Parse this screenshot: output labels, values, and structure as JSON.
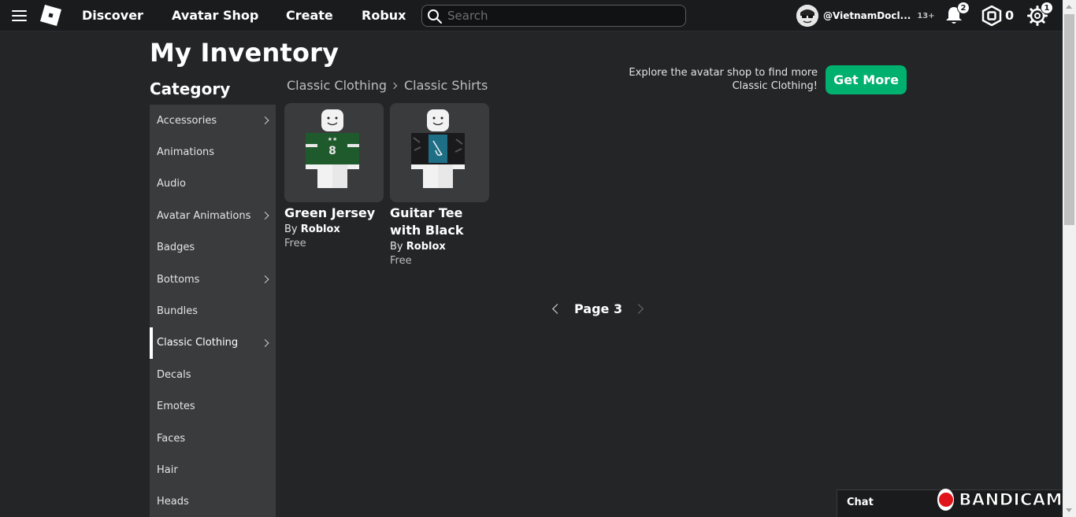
{
  "topbar": {
    "nav": [
      "Discover",
      "Avatar Shop",
      "Create",
      "Robux"
    ],
    "search_placeholder": "Search",
    "username": "@VietnamDocl...",
    "age_label": "13+",
    "notifications_count": "2",
    "robux_balance": "0",
    "settings_badge": "1"
  },
  "page": {
    "title": "My Inventory",
    "category_heading": "Category"
  },
  "sidebar": {
    "items": [
      {
        "label": "Accessories",
        "has_children": true
      },
      {
        "label": "Animations",
        "has_children": false
      },
      {
        "label": "Audio",
        "has_children": false
      },
      {
        "label": "Avatar Animations",
        "has_children": true
      },
      {
        "label": "Badges",
        "has_children": false
      },
      {
        "label": "Bottoms",
        "has_children": true
      },
      {
        "label": "Bundles",
        "has_children": false
      },
      {
        "label": "Classic Clothing",
        "has_children": true,
        "active": true
      },
      {
        "label": "Decals",
        "has_children": false
      },
      {
        "label": "Emotes",
        "has_children": false
      },
      {
        "label": "Faces",
        "has_children": false
      },
      {
        "label": "Hair",
        "has_children": false
      },
      {
        "label": "Heads",
        "has_children": false
      }
    ]
  },
  "breadcrumb": {
    "parent": "Classic Clothing",
    "current": "Classic Shirts"
  },
  "promo": {
    "text": "Explore the avatar shop to find more Classic Clothing!",
    "button_label": "Get More"
  },
  "items": [
    {
      "name": "Green Jersey",
      "by_label": "By",
      "creator": "Roblox",
      "price": "Free",
      "shirt_color": "#1f5a2c",
      "trim_color": "#e8e8e8"
    },
    {
      "name": "Guitar Tee with Black",
      "by_label": "By",
      "creator": "Roblox",
      "price": "Free",
      "shirt_color": "#1a1a1c",
      "trim_color": "#1e6f86"
    }
  ],
  "pager": {
    "label": "Page 3"
  },
  "chat": {
    "label": "Chat"
  },
  "watermark": {
    "text": "BANDICAM"
  },
  "colors": {
    "accent_green": "#00b06f",
    "background": "#232527",
    "topbar": "#191b1d",
    "sidebar": "#393b3d"
  }
}
